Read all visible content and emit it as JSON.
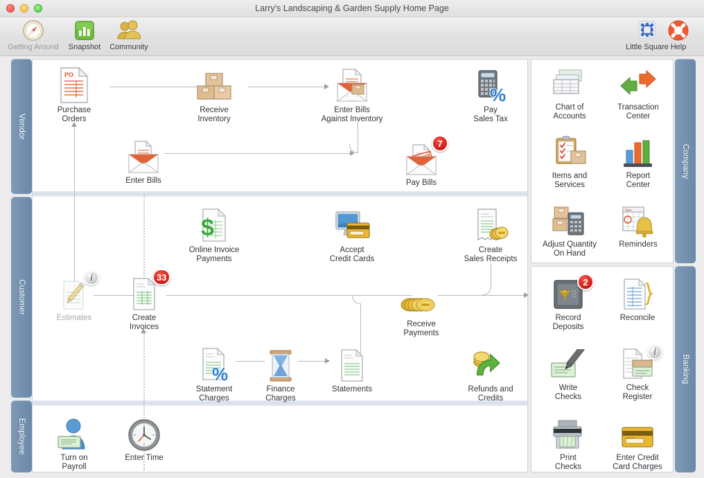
{
  "window": {
    "title": "Larry's Landscaping & Garden Supply Home Page"
  },
  "toolbar": {
    "items": [
      {
        "label": "Getting Around",
        "icon": "compass-icon",
        "dimmed": true
      },
      {
        "label": "Snapshot",
        "icon": "bar-chart-icon",
        "dimmed": false
      },
      {
        "label": "Community",
        "icon": "people-icon",
        "dimmed": false
      }
    ],
    "right_items": [
      {
        "label": "Little Square",
        "icon": "little-square-icon"
      },
      {
        "label": "Help",
        "icon": "life-ring-icon"
      }
    ]
  },
  "sections": {
    "vendor": {
      "label": "Vendor"
    },
    "customer": {
      "label": "Customer"
    },
    "employee": {
      "label": "Employee"
    },
    "company": {
      "label": "Company"
    },
    "banking": {
      "label": "Banking"
    }
  },
  "vendor_nodes": [
    {
      "label": "Purchase\nOrders",
      "icon": "purchase-order-document-icon",
      "badge": null,
      "dimmed": false
    },
    {
      "label": "Receive\nInventory",
      "icon": "boxes-icon",
      "badge": null,
      "dimmed": false
    },
    {
      "label": "Enter Bills\nAgainst Inventory",
      "icon": "envelope-document-box-icon",
      "badge": null,
      "dimmed": false
    },
    {
      "label": "Pay\nSales Tax",
      "icon": "calculator-percent-icon",
      "badge": null,
      "dimmed": false
    },
    {
      "label": "Enter Bills",
      "icon": "envelope-document-icon",
      "badge": null,
      "dimmed": false
    },
    {
      "label": "Pay Bills",
      "icon": "envelope-paid-stamp-icon",
      "badge": "7",
      "dimmed": false
    }
  ],
  "customer_nodes": [
    {
      "label": "Online Invoice\nPayments",
      "icon": "document-dollar-icon",
      "badge": null,
      "dimmed": false
    },
    {
      "label": "Accept\nCredit Cards",
      "icon": "monitor-credit-card-icon",
      "badge": null,
      "dimmed": false
    },
    {
      "label": "Create\nSales Receipts",
      "icon": "receipt-coins-icon",
      "badge": null,
      "dimmed": false
    },
    {
      "label": "Estimates",
      "icon": "document-pencil-icon",
      "badge": null,
      "info": "i",
      "dimmed": true
    },
    {
      "label": "Create\nInvoices",
      "icon": "invoice-document-icon",
      "badge": "33",
      "dimmed": false
    },
    {
      "label": "Receive\nPayments",
      "icon": "coin-stack-icon",
      "badge": null,
      "dimmed": false
    },
    {
      "label": "Statement\nCharges",
      "icon": "document-percent-icon",
      "badge": null,
      "dimmed": false
    },
    {
      "label": "Finance\nCharges",
      "icon": "hourglass-icon",
      "badge": null,
      "dimmed": false
    },
    {
      "label": "Statements",
      "icon": "statement-document-icon",
      "badge": null,
      "dimmed": false
    },
    {
      "label": "Refunds and\nCredits",
      "icon": "coins-green-arrow-icon",
      "badge": null,
      "dimmed": false
    }
  ],
  "employee_nodes": [
    {
      "label": "Turn on\nPayroll",
      "icon": "person-paycheck-icon",
      "badge": null,
      "dimmed": false
    },
    {
      "label": "Enter Time",
      "icon": "clock-icon",
      "badge": null,
      "dimmed": false
    }
  ],
  "company_tiles": [
    {
      "label": "Chart of\nAccounts",
      "icon": "stacked-ledgers-icon",
      "badge": null
    },
    {
      "label": "Transaction\nCenter",
      "icon": "green-orange-arrows-icon",
      "badge": null
    },
    {
      "label": "Items and\nServices",
      "icon": "clipboard-box-icon",
      "badge": null
    },
    {
      "label": "Report\nCenter",
      "icon": "bar-chart-icon",
      "badge": null
    },
    {
      "label": "Adjust Quantity\nOn Hand",
      "icon": "boxes-calculator-icon",
      "badge": null
    },
    {
      "label": "Reminders",
      "icon": "calendar-bell-icon",
      "badge": null
    }
  ],
  "banking_tiles": [
    {
      "label": "Record\nDeposits",
      "icon": "safe-icon",
      "badge": "2"
    },
    {
      "label": "Reconcile",
      "icon": "document-brace-icon",
      "badge": null
    },
    {
      "label": "Write\nChecks",
      "icon": "check-pencil-icon",
      "badge": null
    },
    {
      "label": "Check\nRegister",
      "icon": "register-document-icon",
      "badge": null,
      "info": "i"
    },
    {
      "label": "Print\nChecks",
      "icon": "printer-check-icon",
      "badge": null
    },
    {
      "label": "Enter Credit\nCard Charges",
      "icon": "credit-card-icon",
      "badge": null
    }
  ],
  "colors": {
    "tab_blue": "#7491b0",
    "badge_red": "#d6201a",
    "panel_white": "#ffffff",
    "connector_gray": "#b9b9b9",
    "accent_orange": "#e8652a",
    "accent_green": "#5fae3f"
  }
}
